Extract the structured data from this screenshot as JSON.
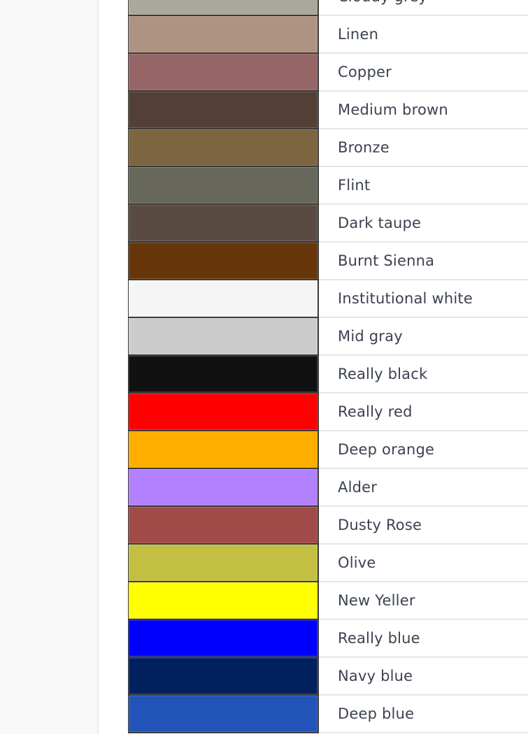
{
  "colors": [
    {
      "name": "Cloudy grey",
      "hex": "#aaa89c"
    },
    {
      "name": "Linen",
      "hex": "#ae9282"
    },
    {
      "name": "Copper",
      "hex": "#966565"
    },
    {
      "name": "Medium brown",
      "hex": "#533f35"
    },
    {
      "name": "Bronze",
      "hex": "#7d653f"
    },
    {
      "name": "Flint",
      "hex": "#68675c"
    },
    {
      "name": "Dark taupe",
      "hex": "#5a4b42"
    },
    {
      "name": "Burnt Sienna",
      "hex": "#67370b"
    },
    {
      "name": "Institutional white",
      "hex": "#f5f5f5"
    },
    {
      "name": "Mid gray",
      "hex": "#cccccc"
    },
    {
      "name": "Really black",
      "hex": "#111111"
    },
    {
      "name": "Really red",
      "hex": "#ff0000"
    },
    {
      "name": "Deep orange",
      "hex": "#ffae00"
    },
    {
      "name": "Alder",
      "hex": "#b380ff"
    },
    {
      "name": "Dusty Rose",
      "hex": "#a14b49"
    },
    {
      "name": "Olive",
      "hex": "#c2bf42"
    },
    {
      "name": "New Yeller",
      "hex": "#ffff00"
    },
    {
      "name": "Really blue",
      "hex": "#0000ff"
    },
    {
      "name": "Navy blue",
      "hex": "#00205e"
    },
    {
      "name": "Deep blue",
      "hex": "#2253b8"
    }
  ]
}
